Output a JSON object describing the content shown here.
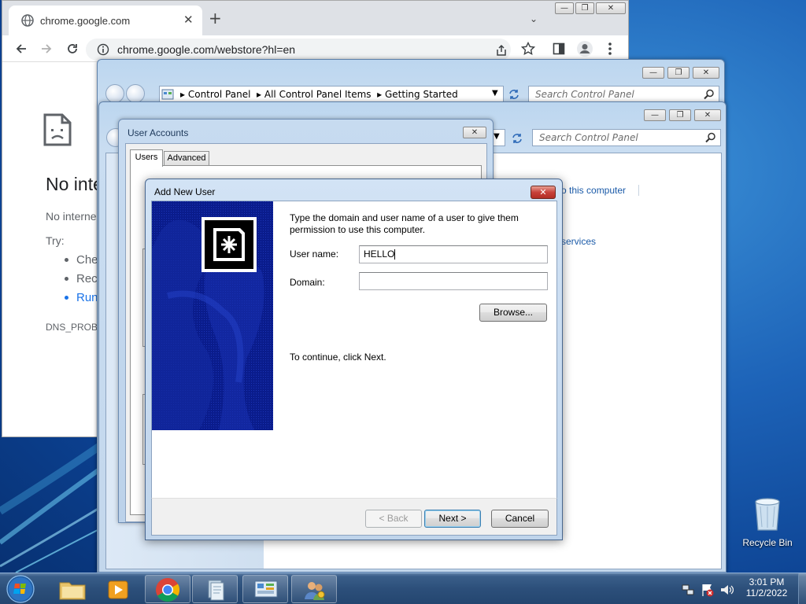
{
  "chrome": {
    "tab_title": "chrome.google.com",
    "tab_close": "✕",
    "new_tab": "+",
    "url": "chrome.google.com/webstore?hl=en",
    "heading": "No inte",
    "subtext": "No interne",
    "try_label": "Try:",
    "suggestions": [
      "Che",
      "Reco",
      "Run"
    ],
    "error_code": "DNS_PROBE_"
  },
  "control_panel_back": {
    "breadcrumb": [
      "Control Panel",
      "All Control Panel Items",
      "Getting Started"
    ],
    "search_placeholder": "Search Control Panel"
  },
  "control_panel_front": {
    "search_placeholder": "Search Control Panel",
    "link_text": "o this computer",
    "services_text": "services"
  },
  "user_accounts": {
    "title": "User Accounts",
    "tabs": [
      "Users",
      "Advanced"
    ],
    "active_tab": "Users"
  },
  "dialog": {
    "title": "Add New User",
    "instruction": "Type the domain and user name of a user to give them permission to use this computer.",
    "username_label": "User name:",
    "username_value": "HELLO",
    "domain_label": "Domain:",
    "domain_value": "",
    "browse_label": "Browse...",
    "continue_text": "To continue, click Next.",
    "back_label": "< Back",
    "next_label": "Next >",
    "cancel_label": "Cancel"
  },
  "desktop": {
    "recycle_bin_label": "Recycle Bin"
  },
  "taskbar": {
    "time": "3:01 PM",
    "date": "11/2/2022"
  },
  "colors": {
    "accent_link": "#1a73e8",
    "close_red": "#c8413a",
    "wizard_blue": "#0a1c8c"
  }
}
